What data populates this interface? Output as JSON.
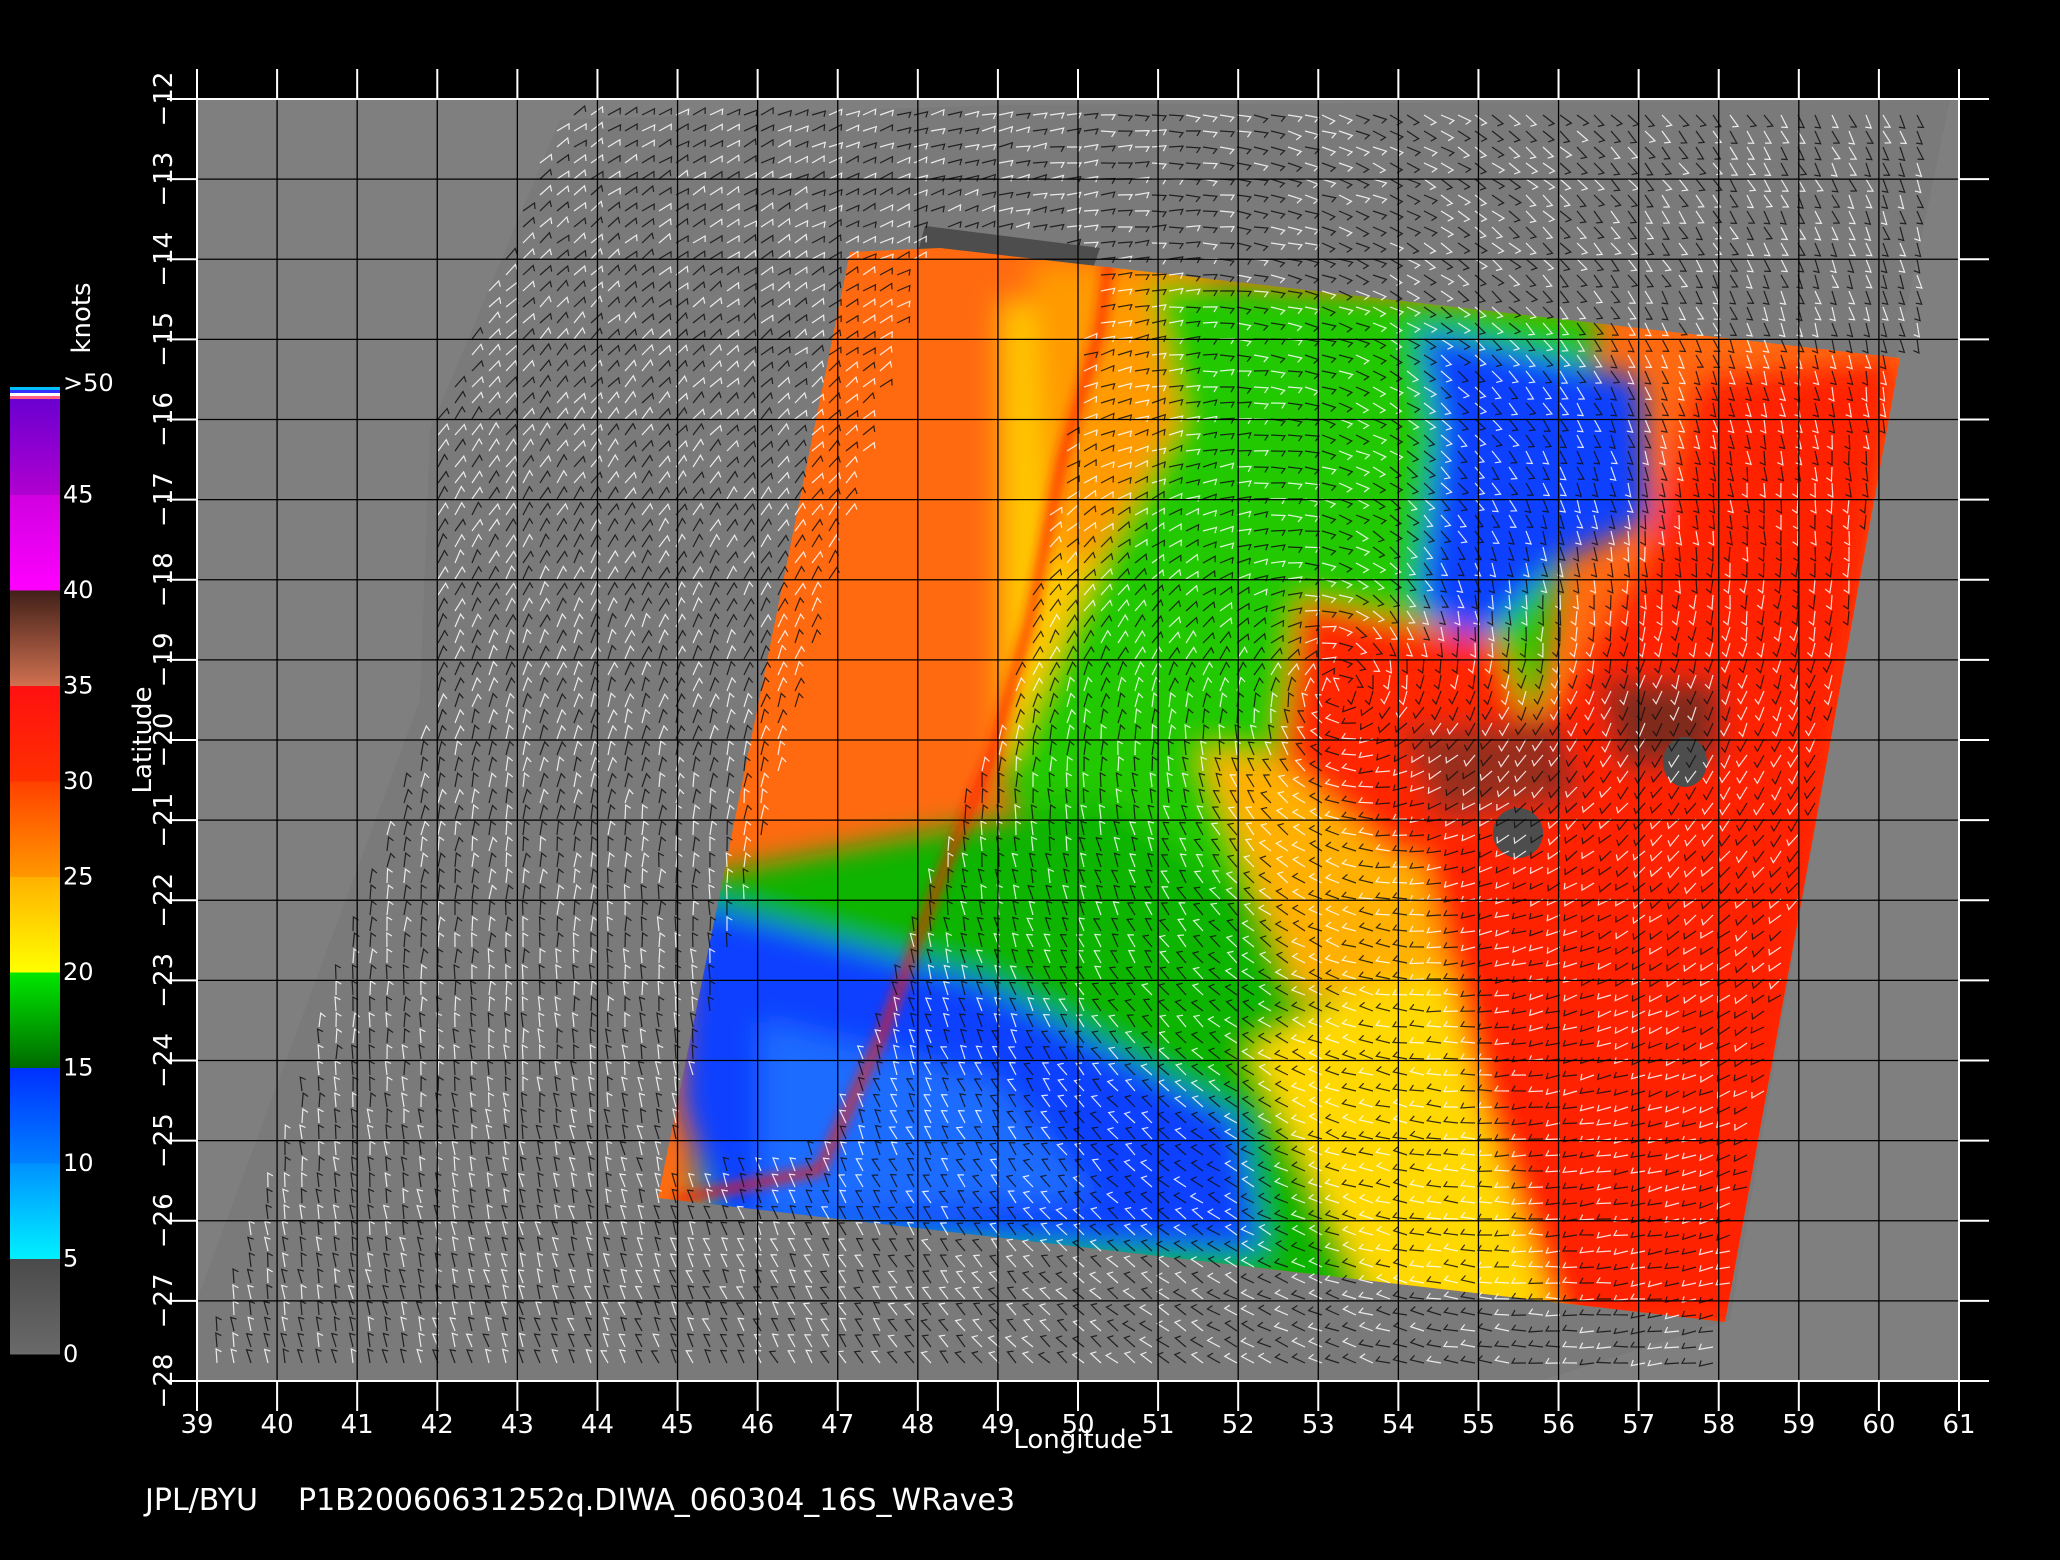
{
  "map": {
    "credit": "JPL/BYU",
    "product": "P1B20060631252q.DIWA_060304_16S_WRave3",
    "xlabel": "Longitude",
    "ylabel": "Latitude",
    "lon_ticks": [
      "39",
      "40",
      "41",
      "42",
      "43",
      "44",
      "45",
      "46",
      "47",
      "48",
      "49",
      "50",
      "51",
      "52",
      "53",
      "54",
      "55",
      "56",
      "57",
      "58",
      "59",
      "60",
      "61"
    ],
    "lat_ticks": [
      "−12",
      "−13",
      "−14",
      "−15",
      "−16",
      "−17",
      "−18",
      "−19",
      "−20",
      "−21",
      "−22",
      "−23",
      "−24",
      "−25",
      "−26",
      "−27",
      "−28"
    ],
    "lon_range": [
      39,
      61
    ],
    "lat_range": [
      -28,
      -12
    ],
    "background_color": "#7f7f7f",
    "land_color": "#4d4d4d"
  },
  "colorbar": {
    "unit": "knots",
    "labels": [
      ">50",
      "45",
      "40",
      "35",
      "30",
      "25",
      "20",
      "15",
      "10",
      "5",
      "0"
    ],
    "bands": [
      {
        "from": 0,
        "to": 5,
        "colors": [
          "#6a6a6a",
          "#4a4a4a"
        ]
      },
      {
        "from": 5,
        "to": 10,
        "colors": [
          "#00f0ff",
          "#0090ff"
        ]
      },
      {
        "from": 10,
        "to": 15,
        "colors": [
          "#0080ff",
          "#0030ff"
        ]
      },
      {
        "from": 15,
        "to": 20,
        "colors": [
          "#006a00",
          "#00e800"
        ]
      },
      {
        "from": 20,
        "to": 25,
        "colors": [
          "#ffff00",
          "#ffb000"
        ]
      },
      {
        "from": 25,
        "to": 30,
        "colors": [
          "#ff9800",
          "#ff4000"
        ]
      },
      {
        "from": 30,
        "to": 35,
        "colors": [
          "#ff3000",
          "#ff1010"
        ]
      },
      {
        "from": 35,
        "to": 40,
        "colors": [
          "#d07050",
          "#402018"
        ]
      },
      {
        "from": 40,
        "to": 45,
        "colors": [
          "#ff00ff",
          "#d000e0"
        ]
      },
      {
        "from": 45,
        "to": 50,
        "colors": [
          "#b000d0",
          "#6a00d0"
        ]
      }
    ],
    "top_marker_colors": [
      "#ff6080",
      "#ffffff",
      "#3030ff",
      "#00c0ff"
    ]
  }
}
